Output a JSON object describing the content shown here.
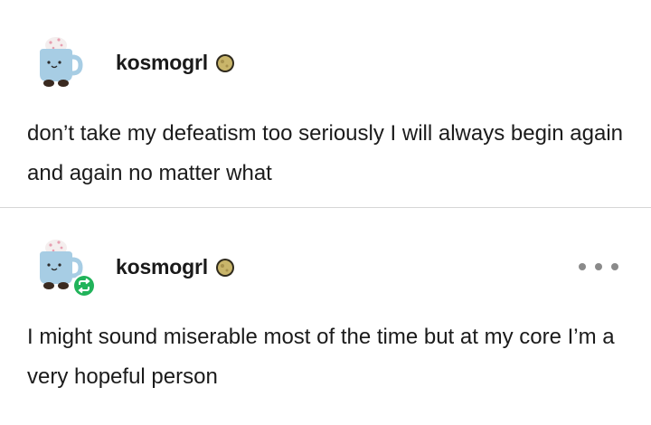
{
  "posts": [
    {
      "username": "kosmogrl",
      "text": "don’t take my defeatism too seriously I will always begin again and again no matter what"
    },
    {
      "username": "kosmogrl",
      "text": "I might sound miserable most of the time but at my core I’m a very hopeful person",
      "reblog_icon": "reblog-icon",
      "more_icon": "more-options-icon"
    }
  ],
  "colors": {
    "reblog_green": "#21b35a",
    "divider": "#d6d6d6",
    "text": "#1b1b1b",
    "dots": "#8a8a8a"
  }
}
